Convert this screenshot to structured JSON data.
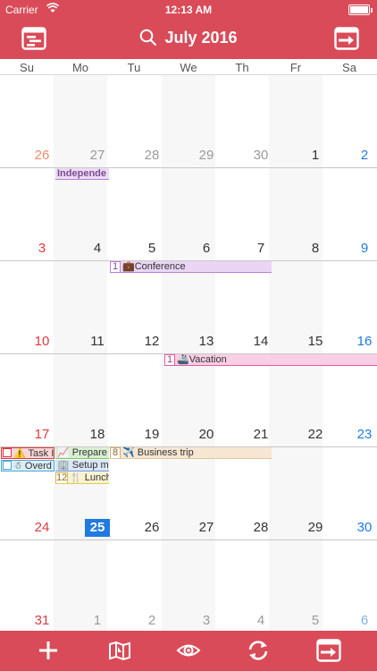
{
  "status_bar": {
    "carrier": "Carrier",
    "time": "12:13 AM"
  },
  "nav": {
    "title": "July 2016",
    "left_icon": "calendar-list-icon",
    "right_icon": "calendar-arrow-icon"
  },
  "weekdays": [
    "Su",
    "Mo",
    "Tu",
    "We",
    "Th",
    "Fr",
    "Sa"
  ],
  "weeks": [
    [
      "26",
      "27",
      "28",
      "29",
      "30",
      "1",
      "2"
    ],
    [
      "3",
      "4",
      "5",
      "6",
      "7",
      "8",
      "9"
    ],
    [
      "10",
      "11",
      "12",
      "13",
      "14",
      "15",
      "16"
    ],
    [
      "17",
      "18",
      "19",
      "20",
      "21",
      "22",
      "23"
    ],
    [
      "24",
      "25",
      "26",
      "27",
      "28",
      "29",
      "30"
    ],
    [
      "31",
      "1",
      "2",
      "3",
      "4",
      "5",
      "6"
    ]
  ],
  "today": "25",
  "events": {
    "independence": {
      "label": "Independe"
    },
    "conference": {
      "badge": "1",
      "label": "💼Conference"
    },
    "vacation": {
      "badge": "1",
      "label": "🚢Vacation"
    },
    "task": {
      "label": "⚠️ Task I"
    },
    "prepare": {
      "label": "📈 Prepare"
    },
    "business_trip": {
      "badge": "8",
      "label": "✈️ Business trip"
    },
    "overdue": {
      "label": "☃ Overd"
    },
    "setup": {
      "label": "🏢 Setup m"
    },
    "lunch": {
      "badge": "12",
      "label": "🍴 Lunch"
    }
  },
  "tab_bar": [
    "plus-icon",
    "map-icon",
    "eye-icon",
    "sync-icon",
    "calendar-arrow-icon"
  ],
  "colors": {
    "accent": "#d94b58",
    "sunday": "#e0393f",
    "saturday": "#1f7be0",
    "today": "#1f7be0",
    "conference": "#b97fd6",
    "vacation": "#e85aa8",
    "business": "#e8c49a"
  }
}
